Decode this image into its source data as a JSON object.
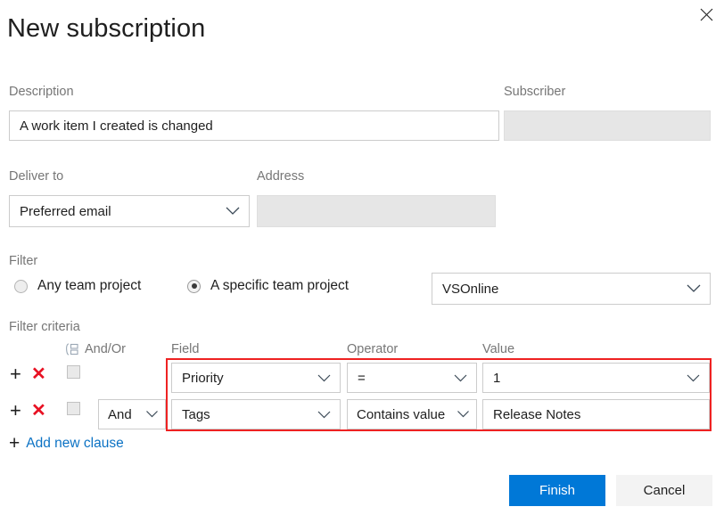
{
  "dialog": {
    "title": "New subscription",
    "close_icon": "close-icon"
  },
  "description": {
    "label": "Description",
    "value": "A work item I created is changed",
    "placeholder": ""
  },
  "subscriber": {
    "label": "Subscriber",
    "value": "",
    "placeholder": ""
  },
  "deliver_to": {
    "label": "Deliver to",
    "value": "Preferred email",
    "options": [
      "Preferred email"
    ]
  },
  "address": {
    "label": "Address",
    "value": "",
    "placeholder": ""
  },
  "filter": {
    "label": "Filter",
    "options": [
      {
        "label": "Any team project",
        "selected": false
      },
      {
        "label": "A specific team project",
        "selected": true
      }
    ],
    "project": {
      "value": "VSOnline",
      "options": [
        "VSOnline"
      ]
    }
  },
  "filter_criteria": {
    "label": "Filter criteria",
    "group_icon": "group-clause-icon",
    "columns": {
      "and_or": "And/Or",
      "field": "Field",
      "operator": "Operator",
      "value": "Value"
    },
    "row_actions": {
      "add": "+",
      "remove": "✕"
    },
    "rows": [
      {
        "checked": false,
        "and_or": "",
        "field": "Priority",
        "operator": "=",
        "value": "1",
        "value_is_dropdown": true
      },
      {
        "checked": false,
        "and_or": "And",
        "field": "Tags",
        "operator": "Contains value",
        "value": "Release Notes",
        "value_is_dropdown": false
      }
    ],
    "add_clause": {
      "plus": "+",
      "label": "Add new clause"
    }
  },
  "footer": {
    "finish_label": "Finish",
    "cancel_label": "Cancel"
  },
  "colors": {
    "primary": "#0078d7",
    "link": "#0b72c4",
    "danger": "#e81123",
    "highlight_box": "#ee2222",
    "label": "#767676",
    "disabled_bg": "#e6e6e6"
  }
}
